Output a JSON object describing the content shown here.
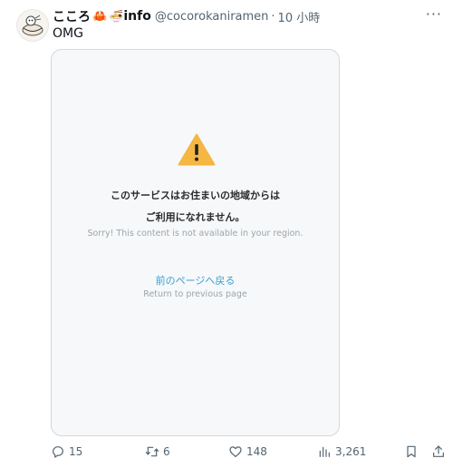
{
  "tweet": {
    "display_name": "こころ",
    "name_suffix": "info",
    "emoji_crab": "🦀",
    "emoji_ramen": "🍜",
    "handle": "@cocorokaniramen",
    "separator": "·",
    "time": "10 小時",
    "more": "···",
    "text": "OMG"
  },
  "media": {
    "line1": "このサービスはお住まいの地域からは",
    "line2": "ご利用になれません。",
    "line3": "Sorry! This content is not available in your region.",
    "back_jp": "前のページへ戻る",
    "back_en": "Return to previous page",
    "warning_color": "#f5b642"
  },
  "actions": {
    "reply": "15",
    "retweet": "6",
    "like": "148",
    "views": "3,261"
  }
}
